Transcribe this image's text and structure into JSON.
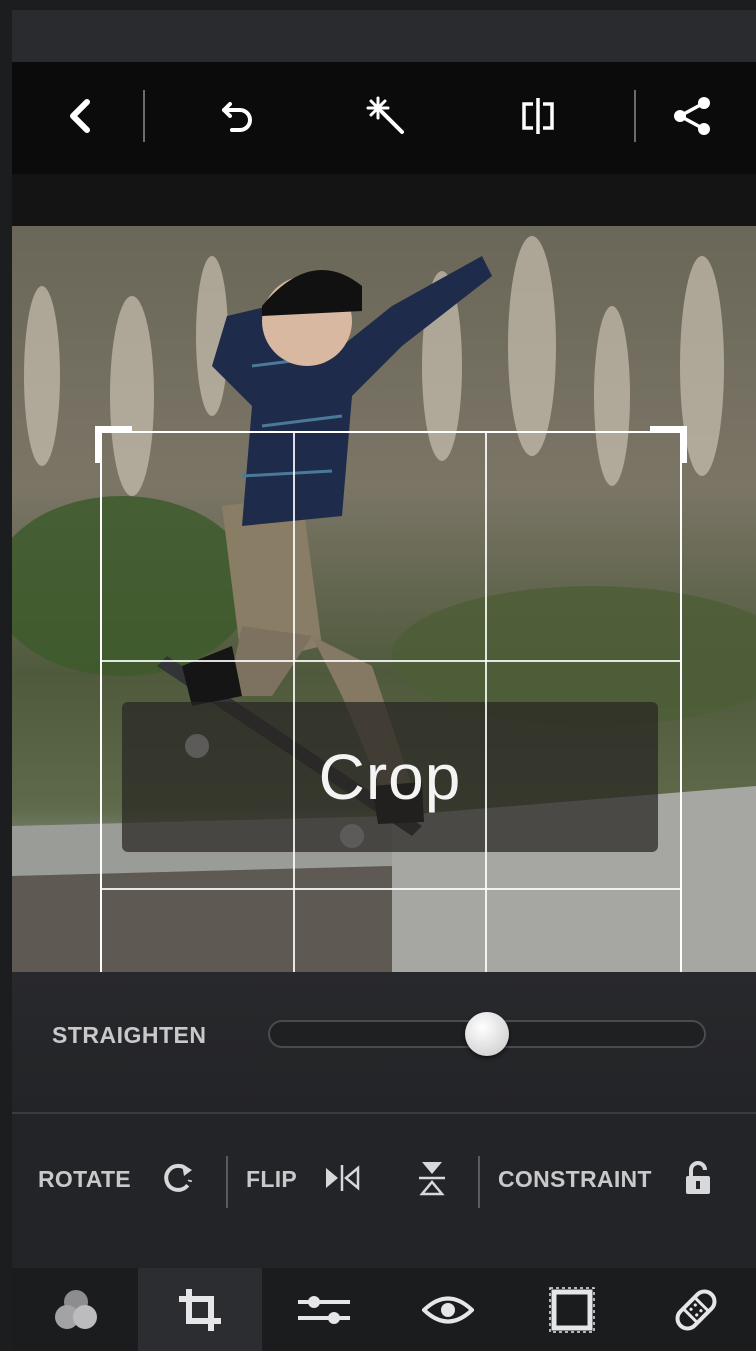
{
  "app": {
    "accent_color": "#ffffff",
    "background_color": "#232427"
  },
  "top_toolbar": {
    "icons": [
      "back-chevron-icon",
      "undo-icon",
      "magic-wand-icon",
      "compare-icon",
      "share-icon"
    ]
  },
  "photo": {
    "subject": "skateboarder photo being cropped",
    "overlay_label": "Crop"
  },
  "straighten": {
    "label": "STRAIGHTEN",
    "value_fraction": 0.5
  },
  "options": {
    "rotate_label": "ROTATE",
    "flip_label": "FLIP",
    "constraint_label": "CONSTRAINT",
    "constraint_locked": false
  },
  "bottom_nav": {
    "items": [
      "looks-icon",
      "crop-icon",
      "adjustments-icon",
      "red-eye-icon",
      "borders-icon",
      "healing-bandage-icon"
    ],
    "active": "crop-icon"
  }
}
